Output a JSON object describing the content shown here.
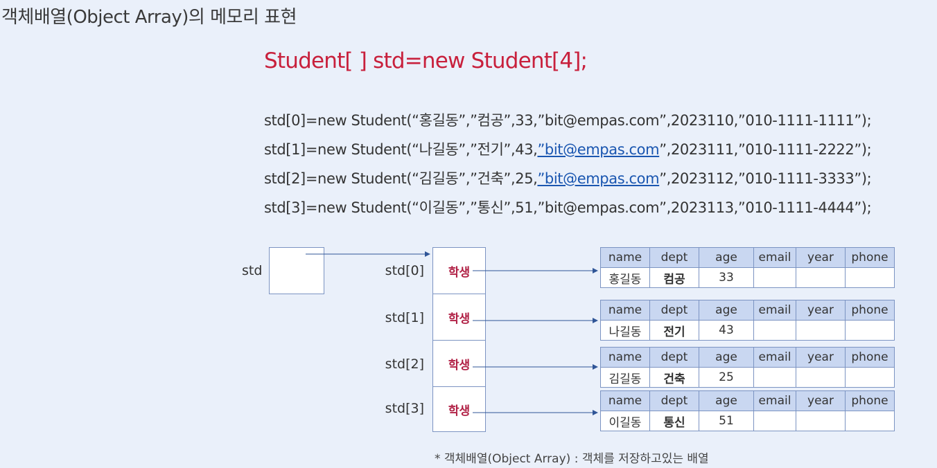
{
  "title": "객체배열(Object Array)의 메모리 표현",
  "declaration": "Student[ ] std=new Student[4];",
  "code_lines": [
    {
      "before": "std[0]=new Student(“홍길동”,”컴공”,33,”bit@empas.com”,2023110,”010-1111-1111”);",
      "link": "",
      "after": ""
    },
    {
      "before": "std[1]=new Student(“나길동”,”전기”,43,",
      "link": "”bit@empas.com",
      "after": "”,2023111,”010-1111-2222”);"
    },
    {
      "before": "std[2]=new Student(“김길동”,”건축”,25,",
      "link": "”bit@empas.com",
      "after": "”,2023112,”010-1111-3333”);"
    },
    {
      "before": "std[3]=new Student(“이길동”,”통신”,51,”bit@empas.com”,2023113,”010-1111-4444”);",
      "link": "",
      "after": ""
    }
  ],
  "ref_label": "std",
  "array_labels": [
    "std[0]",
    "std[1]",
    "std[2]",
    "std[3]"
  ],
  "cell_text": "학생",
  "table_headers": [
    "name",
    "dept",
    "age",
    "email",
    "year",
    "phone"
  ],
  "objects": [
    {
      "name": "홍길동",
      "dept": "컴공",
      "age": "33",
      "email": "",
      "year": "",
      "phone": ""
    },
    {
      "name": "나길동",
      "dept": "전기",
      "age": "43",
      "email": "",
      "year": "",
      "phone": ""
    },
    {
      "name": "김길동",
      "dept": "건축",
      "age": "25",
      "email": "",
      "year": "",
      "phone": ""
    },
    {
      "name": "이길동",
      "dept": "통신",
      "age": "51",
      "email": "",
      "year": "",
      "phone": ""
    }
  ],
  "footnote": "* 객체배열(Object Array) : 객체를 저장하고있는 배열",
  "colors": {
    "declaration": "#c8203c",
    "cell_text": "#b01f44",
    "border": "#7b93c2",
    "header_bg": "#c9d7f1",
    "arrow": "#2f5597",
    "link": "#1a56b0"
  }
}
